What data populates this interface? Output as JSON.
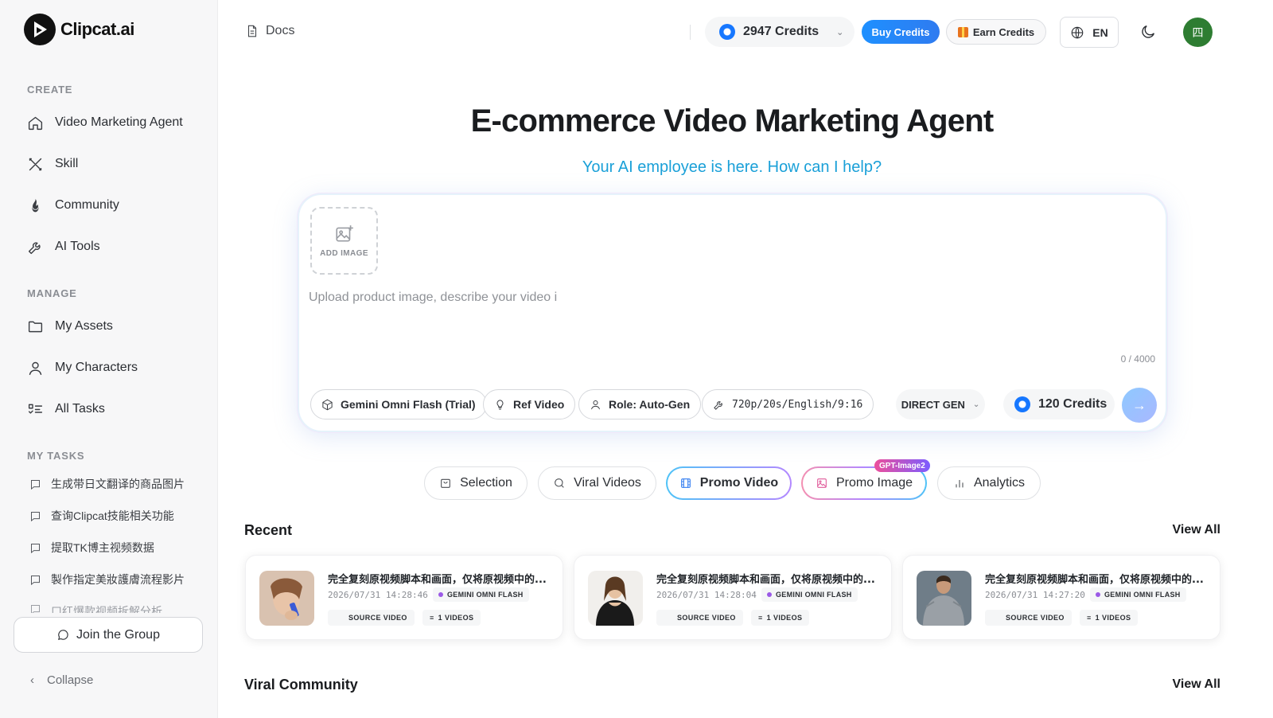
{
  "app": {
    "name": "Clipcat.ai"
  },
  "sidebar": {
    "create_title": "CREATE",
    "create_items": [
      {
        "label": "Video Marketing Agent",
        "icon": "home-icon"
      },
      {
        "label": "Skill",
        "icon": "skill-icon"
      },
      {
        "label": "Community",
        "icon": "flame-icon"
      },
      {
        "label": "AI Tools",
        "icon": "wrench-icon"
      }
    ],
    "manage_title": "MANAGE",
    "manage_items": [
      {
        "label": "My Assets",
        "icon": "folder-icon"
      },
      {
        "label": "My Characters",
        "icon": "user-icon"
      },
      {
        "label": "All Tasks",
        "icon": "task-list-icon"
      }
    ],
    "tasks_title": "MY TASKS",
    "tasks": [
      "生成带日文翻译的商品图片",
      "查询Clipcat技能相关功能",
      "提取TK博主视频数据",
      "製作指定美妝護膚流程影片",
      "口红爆款视频拆解分析"
    ],
    "join_label": "Join the Group",
    "collapse_label": "Collapse"
  },
  "header": {
    "docs_label": "Docs",
    "credits": "2947 Credits",
    "buy_label": "Buy Credits",
    "earn_label": "Earn Credits",
    "lang": "EN",
    "avatar_text": "四",
    "colors": {
      "accent": "#1e90ff",
      "avatar": "#2e7d32"
    }
  },
  "hero": {
    "title": "E-commerce Video Marketing Agent",
    "subtitle": "Your AI employee is here. How can I help?"
  },
  "composer": {
    "add_image_label": "ADD IMAGE",
    "placeholder": "Upload product image, describe your video i",
    "char_count": "0 / 4000",
    "model_label": "Gemini Omni Flash (Trial)",
    "ref_label": "Ref Video",
    "role_label": "Role: Auto-Gen",
    "settings_label": "720p/20s/English/9:16",
    "mode_label": "DIRECT GEN",
    "cost_label": "120 Credits"
  },
  "tabs": [
    {
      "label": "Selection",
      "icon": "bag-icon"
    },
    {
      "label": "Viral Videos",
      "icon": "search-icon"
    },
    {
      "label": "Promo Video",
      "icon": "film-icon",
      "active": true
    },
    {
      "label": "Promo Image",
      "icon": "image-icon",
      "badge": "GPT-Image2"
    },
    {
      "label": "Analytics",
      "icon": "bar-chart-icon"
    }
  ],
  "recent": {
    "title": "Recent",
    "view_all": "View All",
    "cards": [
      {
        "title": "完全复刻原视频脚本和画面，仅将原视频中的...",
        "date": "2026/07/31 14:28:46",
        "model": "GEMINI OMNI FLASH",
        "source": "SOURCE VIDEO",
        "count": "1 VIDEOS"
      },
      {
        "title": "完全复刻原视频脚本和画面，仅将原视频中的...",
        "date": "2026/07/31 14:28:04",
        "model": "GEMINI OMNI FLASH",
        "source": "SOURCE VIDEO",
        "count": "1 VIDEOS"
      },
      {
        "title": "完全复刻原视频脚本和画面，仅将原视频中的...",
        "date": "2026/07/31 14:27:20",
        "model": "GEMINI OMNI FLASH",
        "source": "SOURCE VIDEO",
        "count": "1 VIDEOS"
      }
    ]
  },
  "viral_community": {
    "title": "Viral Community",
    "view_all": "View All"
  }
}
